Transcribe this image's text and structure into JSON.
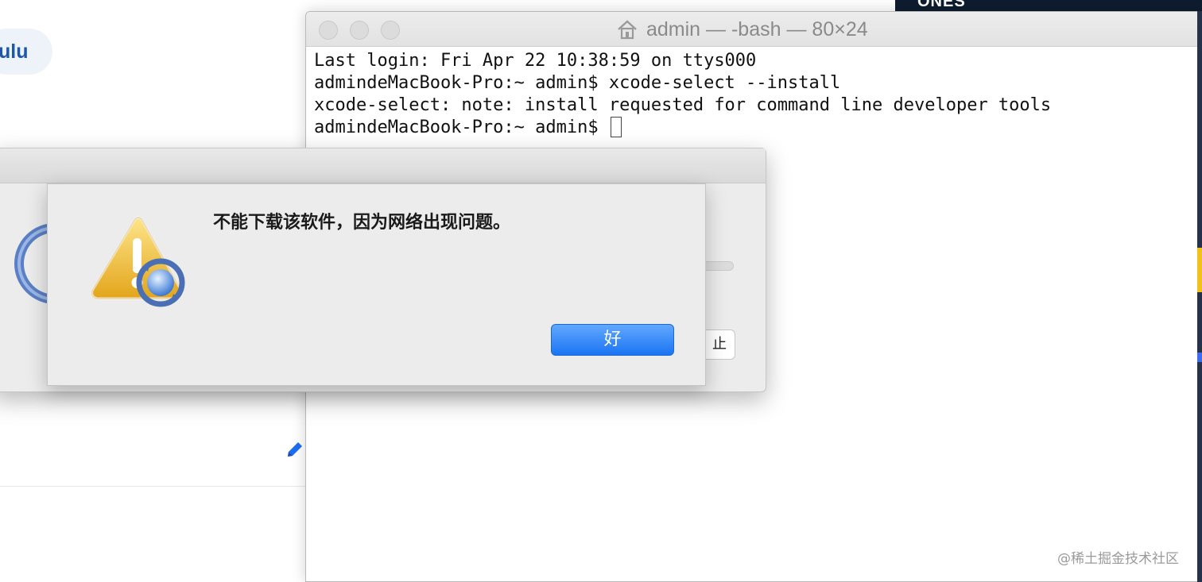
{
  "background_page": {
    "chip_text": "ulu"
  },
  "right_strip": {
    "logo_text": "ONES"
  },
  "terminal": {
    "title": "admin — -bash — 80×24",
    "lines": [
      "Last login: Fri Apr 22 10:38:59 on ttys000",
      "admindeMacBook-Pro:~ admin$ xcode-select --install",
      "xcode-select: note: install requested for command line developer tools",
      "admindeMacBook-Pro:~ admin$ "
    ]
  },
  "background_sheet": {
    "partial_button_label": "止"
  },
  "alert": {
    "message": "不能下载该软件，因为网络出现问题。",
    "ok_label": "好",
    "accent_color": "#1a74f2"
  },
  "watermark": "@稀土掘金技术社区",
  "icons": {
    "terminal_title": "home-icon",
    "alert": "warning-icon",
    "alert_badge": "software-update-icon",
    "background_edit": "pencil-icon"
  }
}
